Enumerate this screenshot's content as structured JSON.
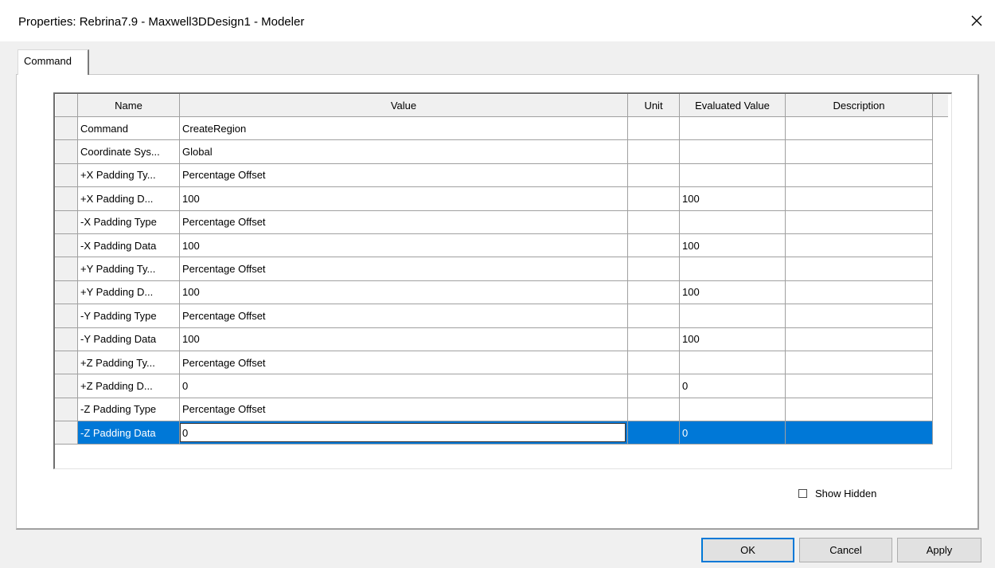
{
  "window": {
    "title": "Properties: Rebrina7.9 - Maxwell3DDesign1 - Modeler",
    "close_glyph": "✕"
  },
  "tabs": [
    {
      "label": "Command"
    }
  ],
  "grid": {
    "columns": [
      "Name",
      "Value",
      "Unit",
      "Evaluated Value",
      "Description"
    ],
    "rows": [
      {
        "name": "Command",
        "value": "CreateRegion",
        "unit": "",
        "evaluated": "",
        "description": ""
      },
      {
        "name": "Coordinate Sys...",
        "value": "Global",
        "unit": "",
        "evaluated": "",
        "description": ""
      },
      {
        "name": "+X Padding Ty...",
        "value": "Percentage Offset",
        "unit": "",
        "evaluated": "",
        "description": ""
      },
      {
        "name": "+X Padding D...",
        "value": "100",
        "unit": "",
        "evaluated": "100",
        "description": ""
      },
      {
        "name": "-X Padding Type",
        "value": "Percentage Offset",
        "unit": "",
        "evaluated": "",
        "description": ""
      },
      {
        "name": "-X Padding Data",
        "value": "100",
        "unit": "",
        "evaluated": "100",
        "description": ""
      },
      {
        "name": "+Y Padding Ty...",
        "value": "Percentage Offset",
        "unit": "",
        "evaluated": "",
        "description": ""
      },
      {
        "name": "+Y Padding D...",
        "value": "100",
        "unit": "",
        "evaluated": "100",
        "description": ""
      },
      {
        "name": "-Y Padding Type",
        "value": "Percentage Offset",
        "unit": "",
        "evaluated": "",
        "description": ""
      },
      {
        "name": "-Y Padding Data",
        "value": "100",
        "unit": "",
        "evaluated": "100",
        "description": ""
      },
      {
        "name": "+Z Padding Ty...",
        "value": "Percentage Offset",
        "unit": "",
        "evaluated": "",
        "description": ""
      },
      {
        "name": "+Z Padding D...",
        "value": "0",
        "unit": "",
        "evaluated": "0",
        "description": ""
      },
      {
        "name": "-Z Padding Type",
        "value": "Percentage Offset",
        "unit": "",
        "evaluated": "",
        "description": ""
      },
      {
        "name": "-Z Padding Data",
        "value": "0",
        "unit": "",
        "evaluated": "0",
        "description": "",
        "selected": true,
        "editing": true
      }
    ]
  },
  "show_hidden": {
    "label": "Show Hidden",
    "checked": false
  },
  "buttons": {
    "ok": "OK",
    "cancel": "Cancel",
    "apply": "Apply"
  },
  "colors": {
    "selection": "#0078d7",
    "default_button_border": "#0078d7"
  }
}
